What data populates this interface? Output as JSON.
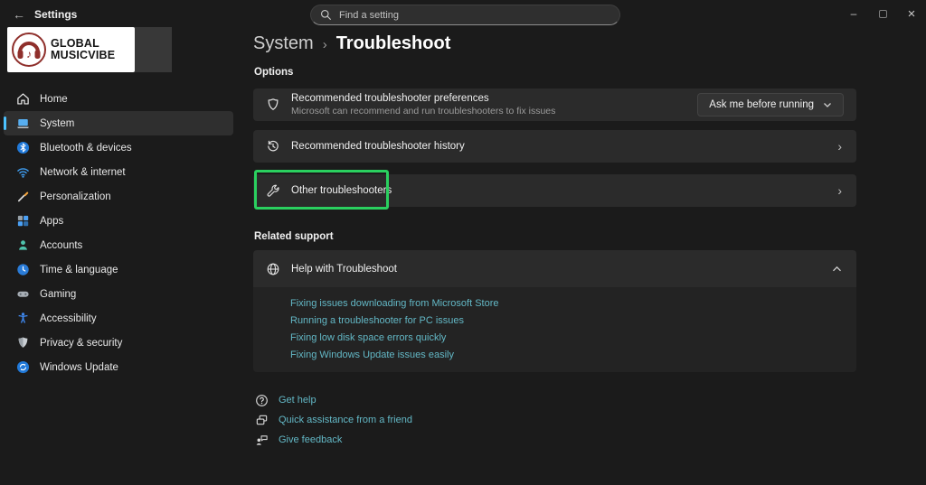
{
  "titlebar": {
    "app_title": "Settings",
    "back_glyph": "←",
    "controls": {
      "minimize": "–",
      "close": "×"
    }
  },
  "search": {
    "placeholder": "Find a setting"
  },
  "logo": {
    "line1": "GLOBAL",
    "line2": "MUSICVIBE",
    "note_glyph": "♪"
  },
  "sidebar": {
    "items": [
      {
        "label": "Home",
        "icon": "home-icon",
        "selected": false
      },
      {
        "label": "System",
        "icon": "system-icon",
        "selected": true
      },
      {
        "label": "Bluetooth & devices",
        "icon": "bluetooth-icon",
        "selected": false
      },
      {
        "label": "Network & internet",
        "icon": "network-icon",
        "selected": false
      },
      {
        "label": "Personalization",
        "icon": "personalization-icon",
        "selected": false
      },
      {
        "label": "Apps",
        "icon": "apps-icon",
        "selected": false
      },
      {
        "label": "Accounts",
        "icon": "accounts-icon",
        "selected": false
      },
      {
        "label": "Time & language",
        "icon": "time-language-icon",
        "selected": false
      },
      {
        "label": "Gaming",
        "icon": "gaming-icon",
        "selected": false
      },
      {
        "label": "Accessibility",
        "icon": "accessibility-icon",
        "selected": false
      },
      {
        "label": "Privacy & security",
        "icon": "privacy-security-icon",
        "selected": false
      },
      {
        "label": "Windows Update",
        "icon": "windows-update-icon",
        "selected": false
      }
    ]
  },
  "main": {
    "breadcrumb": {
      "parent": "System",
      "separator": "›",
      "current": "Troubleshoot"
    },
    "options_label": "Options",
    "preferences_row": {
      "title": "Recommended troubleshooter preferences",
      "subtitle": "Microsoft can recommend and run troubleshooters to fix issues",
      "dropdown_value": "Ask me before running"
    },
    "history_row": {
      "title": "Recommended troubleshooter history",
      "chevron": "›"
    },
    "other_row": {
      "title": "Other troubleshooters",
      "chevron": "›",
      "highlighted": true
    },
    "related_label": "Related support",
    "help_card": {
      "title": "Help with Troubleshoot",
      "links": [
        "Fixing issues downloading from Microsoft Store",
        "Running a troubleshooter for PC issues",
        "Fixing low disk space errors quickly",
        "Fixing Windows Update issues easily"
      ]
    },
    "footer_links": [
      "Get help",
      "Quick assistance from a friend",
      "Give feedback"
    ]
  },
  "colors": {
    "page_bg": "#1b1b1b",
    "card_bg": "#2b2b2b",
    "accent_blue": "#4cc2ff",
    "link_teal": "#63b8c6",
    "highlight_green": "#2ad05f",
    "logo_red": "#8f2f2b"
  }
}
